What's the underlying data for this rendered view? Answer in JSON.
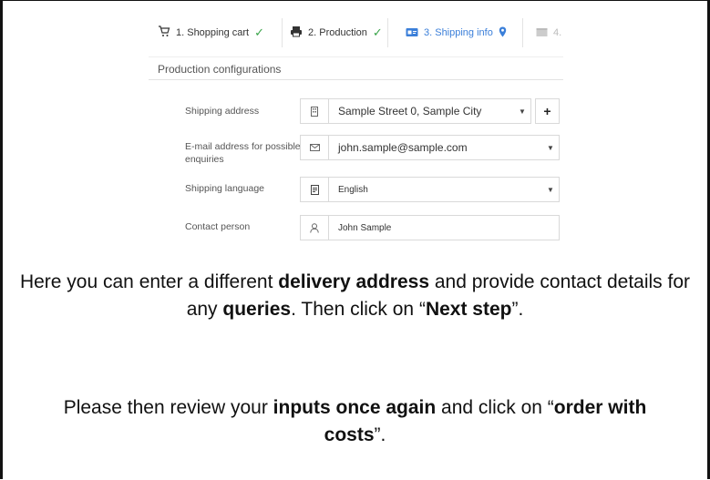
{
  "tabs": [
    {
      "label": "1. Shopping cart",
      "icon": "cart-icon",
      "state": "done"
    },
    {
      "label": "2. Production",
      "icon": "printer-icon",
      "state": "done"
    },
    {
      "label": "3. Shipping info",
      "icon": "id-card-icon",
      "state": "active"
    },
    {
      "label": "4.",
      "icon": "box-icon",
      "state": "disabled"
    }
  ],
  "section_title": "Production configurations",
  "fields": {
    "shipping_address": {
      "label": "Shipping address",
      "value": "Sample Street 0, Sample City",
      "icon": "building-icon"
    },
    "email": {
      "label": "E-mail address for possible enquiries",
      "value": "john.sample@sample.com",
      "icon": "envelope-icon"
    },
    "language": {
      "label": "Shipping language",
      "value": "English",
      "icon": "document-icon"
    },
    "contact": {
      "label": "Contact person",
      "value": "John Sample",
      "icon": "person-icon"
    }
  },
  "add_address_label": "+",
  "instructions": {
    "p1": {
      "t1": "Here you can enter a different ",
      "b1": "delivery address",
      "t2": " and provide contact details for any ",
      "b2": "queries",
      "t3": ". Then click on “",
      "b3": "Next step",
      "t4": "”."
    },
    "p2": {
      "t1": "Please then review your ",
      "b1": "inputs once again",
      "t2": " and click on “",
      "b2": "order with costs",
      "t3": "”."
    }
  },
  "colors": {
    "accent": "#3b7fd9",
    "check": "#3aa44a"
  }
}
